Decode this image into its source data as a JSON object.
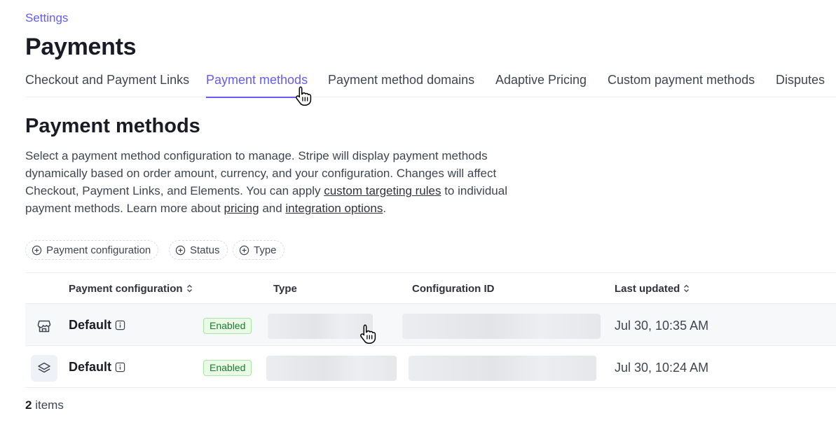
{
  "breadcrumb": "Settings",
  "page_title": "Payments",
  "tabs": [
    {
      "label": "Checkout and Payment Links",
      "active": false
    },
    {
      "label": "Payment methods",
      "active": true
    },
    {
      "label": "Payment method domains",
      "active": false
    },
    {
      "label": "Adaptive Pricing",
      "active": false
    },
    {
      "label": "Custom payment methods",
      "active": false
    },
    {
      "label": "Disputes",
      "active": false
    }
  ],
  "section_title": "Payment methods",
  "description": {
    "part1": "Select a payment method configuration to manage. Stripe will display payment methods dynamically based on order amount, currency, and your configuration. Changes will affect Checkout, Payment Links, and Elements. You can apply ",
    "link1": "custom targeting rules",
    "part2": " to individual payment methods. Learn more about ",
    "link2": "pricing",
    "part3": " and ",
    "link3": "integration options",
    "part4": "."
  },
  "filters": [
    "Payment configuration",
    "Status",
    "Type"
  ],
  "table": {
    "columns": {
      "config": "Payment configuration",
      "type": "Type",
      "config_id": "Configuration ID",
      "updated": "Last updated"
    },
    "rows": [
      {
        "icon": "storefront-icon",
        "name": "Default",
        "status": "Enabled",
        "updated": "Jul 30, 10:35 AM"
      },
      {
        "icon": "layers-icon",
        "name": "Default",
        "status": "Enabled",
        "updated": "Jul 30, 10:24 AM"
      }
    ]
  },
  "footer": {
    "count": "2",
    "label": "items"
  },
  "colors": {
    "accent": "#635bff",
    "enabled_bg": "#e9fbe6",
    "enabled_text": "#1f7a2e"
  }
}
